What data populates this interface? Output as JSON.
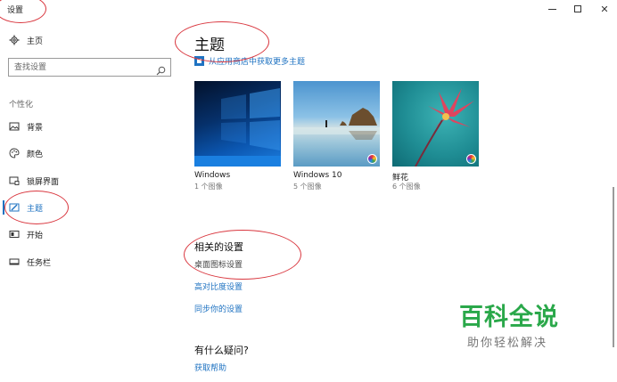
{
  "window": {
    "title": "设置",
    "controls": {
      "minimize": "—",
      "maximize": "☐",
      "close": "✕"
    }
  },
  "sidebar": {
    "home": {
      "label": "主页",
      "icon": "gear-icon"
    },
    "search": {
      "placeholder": "查找设置",
      "icon": "search-icon"
    },
    "section_label": "个性化",
    "items": [
      {
        "label": "背景",
        "icon": "picture-icon",
        "active": false
      },
      {
        "label": "颜色",
        "icon": "palette-icon",
        "active": false
      },
      {
        "label": "锁屏界面",
        "icon": "lock-screen-icon",
        "active": false
      },
      {
        "label": "主题",
        "icon": "brush-icon",
        "active": true
      },
      {
        "label": "开始",
        "icon": "start-menu-icon",
        "active": false
      },
      {
        "label": "任务栏",
        "icon": "taskbar-icon",
        "active": false
      }
    ]
  },
  "main": {
    "title": "主题",
    "store_link": "从应用商店中获取更多主题",
    "themes": [
      {
        "name": "Windows",
        "count": "1 个图像"
      },
      {
        "name": "Windows 10",
        "count": "5 个图像"
      },
      {
        "name": "鲜花",
        "count": "6 个图像"
      }
    ],
    "related": {
      "title": "相关的设置",
      "links": [
        "桌面图标设置",
        "高对比度设置",
        "同步你的设置"
      ]
    },
    "faq": {
      "title": "有什么疑问?",
      "link": "获取帮助"
    }
  },
  "watermark": {
    "main": "百科全说",
    "sub": "助你轻松解决"
  },
  "colors": {
    "accent": "#1f73c2",
    "annotation": "#d9363e",
    "watermark_green": "#2aa84a"
  }
}
